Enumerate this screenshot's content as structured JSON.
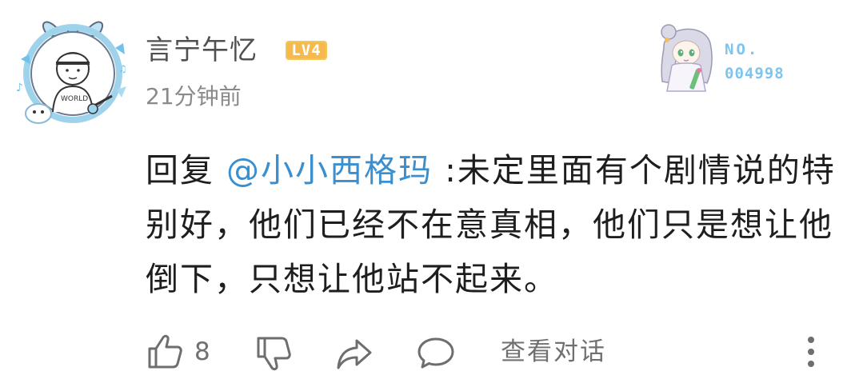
{
  "user": {
    "name": "言宁午忆",
    "level_badge": "LV4",
    "timestamp": "21分钟前",
    "avatar_text": "WORLD"
  },
  "fan_badge": {
    "label": "NO.",
    "number": "004998"
  },
  "comment": {
    "reply_prefix": "回复",
    "mention": "@小小西格玛",
    "text": ":未定里面有个剧情说的特别好，他们已经不在意真相，他们只是想让他倒下，只想让他站不起来。"
  },
  "actions": {
    "like_count": "8",
    "view_dialog_label": "查看对话"
  },
  "colors": {
    "mention": "#3a8fd0",
    "level_badge_bg": "#f3c65a",
    "fan_badge_text": "#7dc5ee"
  }
}
